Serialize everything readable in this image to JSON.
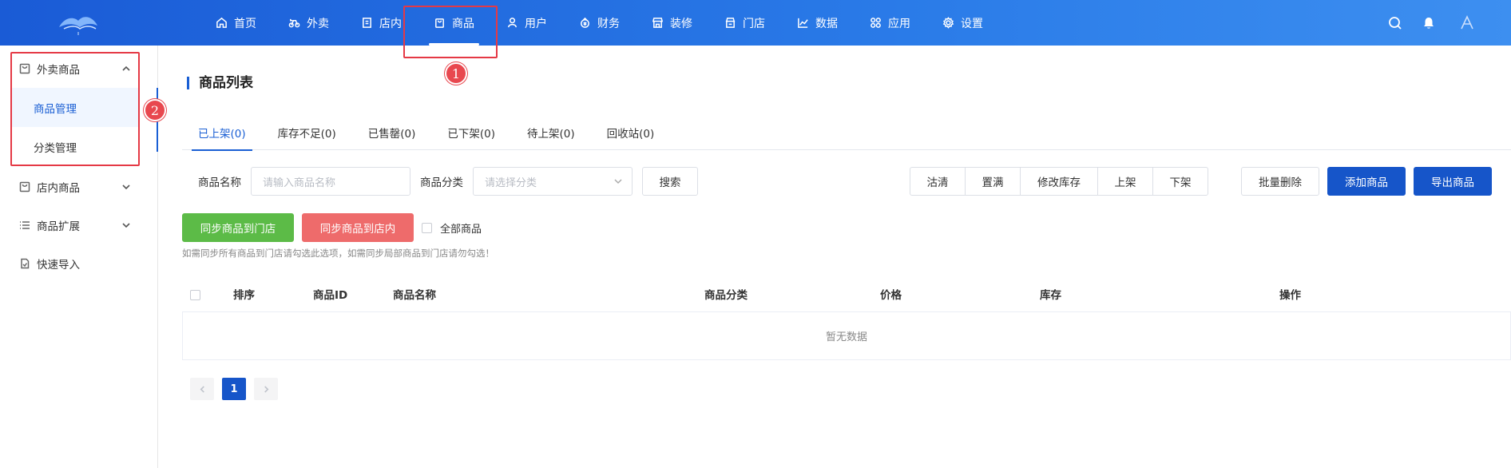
{
  "nav": {
    "items": [
      {
        "label": "首页",
        "icon": "home-icon"
      },
      {
        "label": "外卖",
        "icon": "bike-icon"
      },
      {
        "label": "店内",
        "icon": "store-in-icon"
      },
      {
        "label": "商品",
        "icon": "bag-icon"
      },
      {
        "label": "用户",
        "icon": "user-icon"
      },
      {
        "label": "财务",
        "icon": "money-icon"
      },
      {
        "label": "装修",
        "icon": "shop-decor-icon"
      },
      {
        "label": "门店",
        "icon": "shop-icon"
      },
      {
        "label": "数据",
        "icon": "chart-icon"
      },
      {
        "label": "应用",
        "icon": "apps-icon"
      },
      {
        "label": "设置",
        "icon": "gear-icon"
      }
    ],
    "active": "商品"
  },
  "sidebar": {
    "groups": [
      {
        "label": "外卖商品",
        "expanded": true,
        "children": [
          "商品管理",
          "分类管理"
        ]
      },
      {
        "label": "店内商品",
        "expanded": false
      },
      {
        "label": "商品扩展",
        "expanded": false
      },
      {
        "label": "快速导入"
      }
    ],
    "active_child": "商品管理"
  },
  "annotations": {
    "one": "1",
    "two": "2"
  },
  "colors": {
    "accent": "#1a5fd4",
    "primary_btn": "#1655c9",
    "green_btn": "#5cbb47",
    "red_btn": "#ee6b6b",
    "annotation": "#e53945"
  },
  "main": {
    "title": "商品列表",
    "tabs": [
      "已上架(0)",
      "库存不足(0)",
      "已售罄(0)",
      "已下架(0)",
      "待上架(0)",
      "回收站(0)"
    ],
    "active_tab": "已上架(0)",
    "filters": {
      "name_label": "商品名称",
      "name_placeholder": "请输入商品名称",
      "category_label": "商品分类",
      "category_placeholder": "请选择分类",
      "search_btn": "搜索"
    },
    "batch_buttons": [
      "沽清",
      "置满",
      "修改库存",
      "上架",
      "下架"
    ],
    "batch_delete": "批量删除",
    "add_product": "添加商品",
    "export_product": "导出商品",
    "sync_store": "同步商品到门店",
    "sync_in_store": "同步商品到店内",
    "all_products": "全部商品",
    "hint": "如需同步所有商品到门店请勾选此选项，如需同步局部商品到门店请勿勾选！",
    "table": {
      "headers": [
        "排序",
        "商品ID",
        "商品名称",
        "商品分类",
        "价格",
        "库存",
        "操作"
      ],
      "empty": "暂无数据"
    },
    "pagination": {
      "current": "1"
    }
  }
}
